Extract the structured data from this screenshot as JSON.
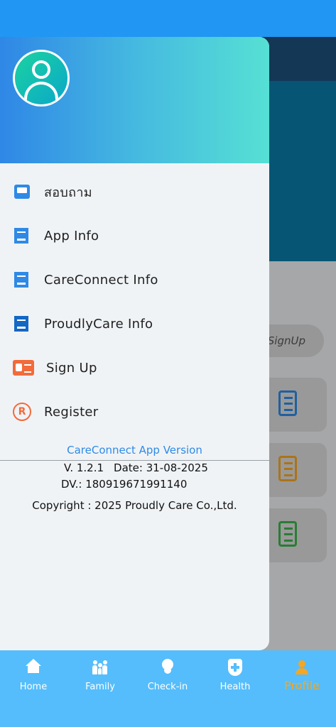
{
  "drawer": {
    "menu": [
      {
        "label": "สอบถาม",
        "icon": "inbox-icon"
      },
      {
        "label": "App Info",
        "icon": "document-icon"
      },
      {
        "label": "CareConnect Info",
        "icon": "document-icon"
      },
      {
        "label": "ProudlyCare Info",
        "icon": "document-icon"
      },
      {
        "label": "Sign Up",
        "icon": "id-card-icon"
      },
      {
        "label": "Register",
        "icon": "registered-icon"
      }
    ],
    "version_title": "CareConnect App Version",
    "version": "V. 1.2.1",
    "date": "Date: 31-08-2025",
    "dv": "DV.: 180919671991140",
    "copyright": "Copyright : 2025 Proudly Care Co.,Ltd."
  },
  "background": {
    "signup_label": "SignUp"
  },
  "bottom_nav": [
    {
      "label": "Home",
      "icon": "home-icon"
    },
    {
      "label": "Family",
      "icon": "family-icon"
    },
    {
      "label": "Check-in",
      "icon": "location-pin-icon"
    },
    {
      "label": "Health",
      "icon": "shield-plus-icon"
    },
    {
      "label": "Profile",
      "icon": "user-icon",
      "active": true
    }
  ],
  "colors": {
    "primary": "#2196F3",
    "accent_orange": "#F26B3A",
    "nav_active": "#F5A623",
    "nav_bg": "#55BDFB"
  }
}
